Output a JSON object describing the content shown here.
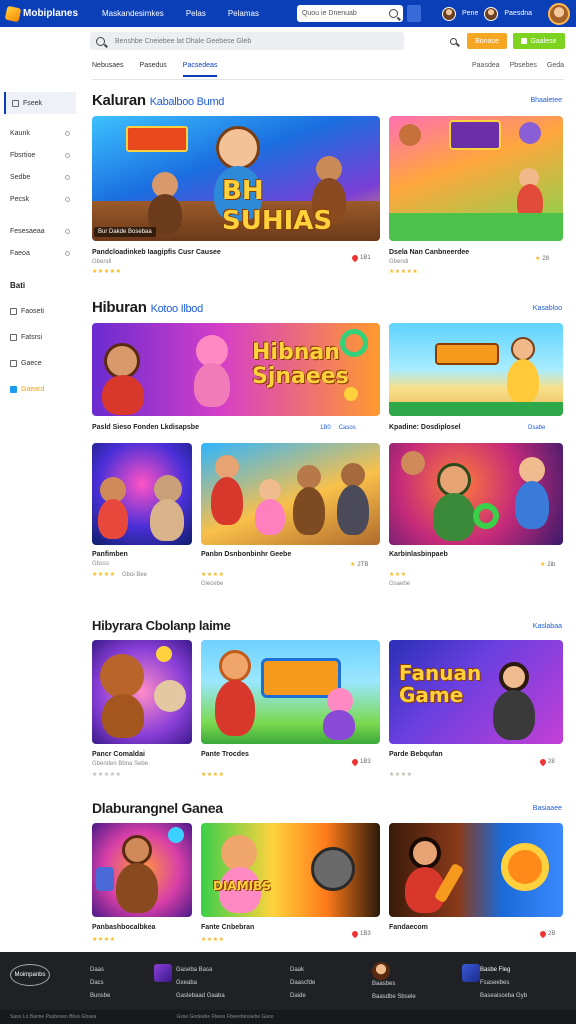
{
  "topbar": {
    "logo": "Mobiplanes",
    "nav": [
      "Maskandesimkes",
      "Pelas",
      "Pelamas"
    ],
    "search_placeholder": "Quou ie Dnenuab",
    "user_label": "Pene",
    "user2_label": "Paesdna"
  },
  "searchbar": {
    "placeholder": "Benshbe Cneiebee lat Dhale Geebese Gleb",
    "btn_orange": "Bonase",
    "btn_green": "Gaalese"
  },
  "tabs": {
    "items": [
      "Nebusaes",
      "Pasedus",
      "Pacsedeas"
    ],
    "right": [
      "Paasdea",
      "Pbsebes",
      "Geda"
    ]
  },
  "sidebar": {
    "items": [
      "Fseek",
      "Kaunk",
      "Fbsrtioe",
      "Sedbe",
      "Pecsk",
      "Fesesaeaa",
      "Faeoa"
    ],
    "heading": "Bati",
    "checks": [
      "Faoseti",
      "Fatsrsi",
      "Gaece",
      "Gaeard"
    ]
  },
  "sections": [
    {
      "title": "Kaluran",
      "subtitle": "Kabalboo Bumd",
      "see_all": "Bhaaletee",
      "cards": [
        {
          "caption": "Pandcloadinkeb Iaagipfis Cusr Causee",
          "meta": "Gbendi",
          "stars": "★★★★★",
          "tag": "1B1",
          "overlay": "Bur Dakde Bosebaa"
        },
        {
          "caption": "Dsela Nan Canbneerdee",
          "meta": "Gbendi",
          "stars": "★★★★★",
          "tag": "28"
        }
      ]
    },
    {
      "title": "Hiburan",
      "subtitle": "Kotoo Ilbod",
      "see_all": "Kasabloo",
      "banner_left_caption": "Pasld Sieso Fonden Lkdisapsbe",
      "banner_left_tag": "1B0",
      "banner_left_tag2": "Casos",
      "banner_right_caption": "Kpadine: Dosdiplosel",
      "banner_right_tag": "Dsabe",
      "cards": [
        {
          "caption": "Panfimben",
          "meta": "Gbsss",
          "stars": "★★★★",
          "meta2": "Gboi Bee"
        },
        {
          "caption": "Panbn Dsnbonbinhr Geebe",
          "meta": "Giecebe",
          "stars": "★★★★",
          "tag": "2TB"
        },
        {
          "caption": "Karbinlasbinpaeb",
          "meta": "Gsaebe",
          "stars": "★★★",
          "tag": "2ib"
        }
      ]
    },
    {
      "title": "Hibyrara Cbolanp laime",
      "subtitle": "",
      "see_all": "Kaslabaa",
      "cards": [
        {
          "caption": "Pancr Comaldai",
          "meta": "Gbenden Bbna Sebe",
          "stars": "★★★★★",
          "tag": ""
        },
        {
          "caption": "Pante Trocdes",
          "meta": "",
          "stars": "★★★★",
          "tag": "1B3"
        },
        {
          "caption": "Parde Bebqufan",
          "meta": "",
          "stars": "★★★★",
          "tag": "28"
        }
      ]
    },
    {
      "title": "Dlaburangnel Ganea",
      "subtitle": "",
      "see_all": "Basiaaee",
      "cards": [
        {
          "caption": "Panbashbocalbkea",
          "meta": "",
          "stars": "★★★★",
          "tag": ""
        },
        {
          "caption": "Fante Cnbebran",
          "meta": "",
          "stars": "★★★★",
          "tag": "1B3"
        },
        {
          "caption": "Fandaecom",
          "meta": "",
          "stars": "",
          "tag": "2B"
        }
      ]
    }
  ],
  "footer": {
    "logo": "Moimpanbs",
    "col1": [
      "Daas",
      "Dacs",
      "Bunsbe"
    ],
    "col2": [
      "Gaseba Basa",
      "Gxeaba",
      "Gaslebaad Gaaba"
    ],
    "col3": [
      "Daak",
      "Daascfde",
      "Daide"
    ],
    "col4": [
      "Baasbes",
      "Baasdbe Sbsele"
    ],
    "col5": [
      "Basbe Fleg",
      "Fsaseebes",
      "Baseaisceba Gyb"
    ],
    "bottom": [
      "Saso Lo Banne Pasbeseo Bbes Ebaea",
      "Gsse Gedeebe Fbees Fbeeebesaebe Gaso"
    ]
  }
}
